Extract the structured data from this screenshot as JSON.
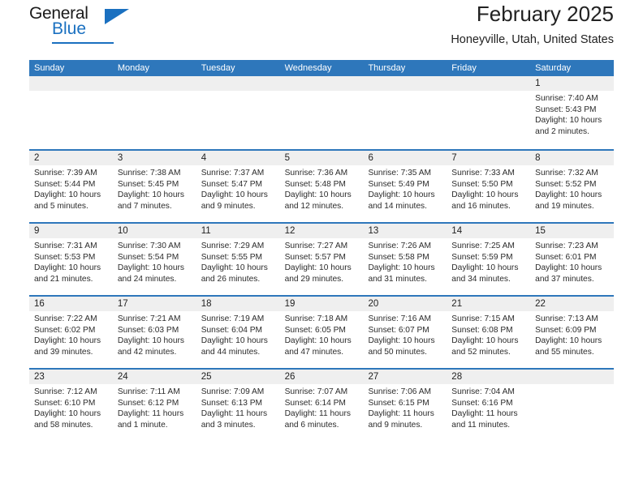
{
  "brand": {
    "name_part1": "General",
    "name_part2": "Blue",
    "accent_color": "#1a70c0",
    "triangle_icon": "triangle-icon"
  },
  "header": {
    "title": "February 2025",
    "subtitle": "Honeyville, Utah, United States"
  },
  "calendar": {
    "header_bg": "#2e77bb",
    "header_text_color": "#ffffff",
    "daynum_band_bg": "#efefef",
    "weekdays": [
      "Sunday",
      "Monday",
      "Tuesday",
      "Wednesday",
      "Thursday",
      "Friday",
      "Saturday"
    ],
    "weeks": [
      [
        {
          "day": "",
          "sunrise": "",
          "sunset": "",
          "daylight": ""
        },
        {
          "day": "",
          "sunrise": "",
          "sunset": "",
          "daylight": ""
        },
        {
          "day": "",
          "sunrise": "",
          "sunset": "",
          "daylight": ""
        },
        {
          "day": "",
          "sunrise": "",
          "sunset": "",
          "daylight": ""
        },
        {
          "day": "",
          "sunrise": "",
          "sunset": "",
          "daylight": ""
        },
        {
          "day": "",
          "sunrise": "",
          "sunset": "",
          "daylight": ""
        },
        {
          "day": "1",
          "sunrise": "Sunrise: 7:40 AM",
          "sunset": "Sunset: 5:43 PM",
          "daylight": "Daylight: 10 hours and 2 minutes."
        }
      ],
      [
        {
          "day": "2",
          "sunrise": "Sunrise: 7:39 AM",
          "sunset": "Sunset: 5:44 PM",
          "daylight": "Daylight: 10 hours and 5 minutes."
        },
        {
          "day": "3",
          "sunrise": "Sunrise: 7:38 AM",
          "sunset": "Sunset: 5:45 PM",
          "daylight": "Daylight: 10 hours and 7 minutes."
        },
        {
          "day": "4",
          "sunrise": "Sunrise: 7:37 AM",
          "sunset": "Sunset: 5:47 PM",
          "daylight": "Daylight: 10 hours and 9 minutes."
        },
        {
          "day": "5",
          "sunrise": "Sunrise: 7:36 AM",
          "sunset": "Sunset: 5:48 PM",
          "daylight": "Daylight: 10 hours and 12 minutes."
        },
        {
          "day": "6",
          "sunrise": "Sunrise: 7:35 AM",
          "sunset": "Sunset: 5:49 PM",
          "daylight": "Daylight: 10 hours and 14 minutes."
        },
        {
          "day": "7",
          "sunrise": "Sunrise: 7:33 AM",
          "sunset": "Sunset: 5:50 PM",
          "daylight": "Daylight: 10 hours and 16 minutes."
        },
        {
          "day": "8",
          "sunrise": "Sunrise: 7:32 AM",
          "sunset": "Sunset: 5:52 PM",
          "daylight": "Daylight: 10 hours and 19 minutes."
        }
      ],
      [
        {
          "day": "9",
          "sunrise": "Sunrise: 7:31 AM",
          "sunset": "Sunset: 5:53 PM",
          "daylight": "Daylight: 10 hours and 21 minutes."
        },
        {
          "day": "10",
          "sunrise": "Sunrise: 7:30 AM",
          "sunset": "Sunset: 5:54 PM",
          "daylight": "Daylight: 10 hours and 24 minutes."
        },
        {
          "day": "11",
          "sunrise": "Sunrise: 7:29 AM",
          "sunset": "Sunset: 5:55 PM",
          "daylight": "Daylight: 10 hours and 26 minutes."
        },
        {
          "day": "12",
          "sunrise": "Sunrise: 7:27 AM",
          "sunset": "Sunset: 5:57 PM",
          "daylight": "Daylight: 10 hours and 29 minutes."
        },
        {
          "day": "13",
          "sunrise": "Sunrise: 7:26 AM",
          "sunset": "Sunset: 5:58 PM",
          "daylight": "Daylight: 10 hours and 31 minutes."
        },
        {
          "day": "14",
          "sunrise": "Sunrise: 7:25 AM",
          "sunset": "Sunset: 5:59 PM",
          "daylight": "Daylight: 10 hours and 34 minutes."
        },
        {
          "day": "15",
          "sunrise": "Sunrise: 7:23 AM",
          "sunset": "Sunset: 6:01 PM",
          "daylight": "Daylight: 10 hours and 37 minutes."
        }
      ],
      [
        {
          "day": "16",
          "sunrise": "Sunrise: 7:22 AM",
          "sunset": "Sunset: 6:02 PM",
          "daylight": "Daylight: 10 hours and 39 minutes."
        },
        {
          "day": "17",
          "sunrise": "Sunrise: 7:21 AM",
          "sunset": "Sunset: 6:03 PM",
          "daylight": "Daylight: 10 hours and 42 minutes."
        },
        {
          "day": "18",
          "sunrise": "Sunrise: 7:19 AM",
          "sunset": "Sunset: 6:04 PM",
          "daylight": "Daylight: 10 hours and 44 minutes."
        },
        {
          "day": "19",
          "sunrise": "Sunrise: 7:18 AM",
          "sunset": "Sunset: 6:05 PM",
          "daylight": "Daylight: 10 hours and 47 minutes."
        },
        {
          "day": "20",
          "sunrise": "Sunrise: 7:16 AM",
          "sunset": "Sunset: 6:07 PM",
          "daylight": "Daylight: 10 hours and 50 minutes."
        },
        {
          "day": "21",
          "sunrise": "Sunrise: 7:15 AM",
          "sunset": "Sunset: 6:08 PM",
          "daylight": "Daylight: 10 hours and 52 minutes."
        },
        {
          "day": "22",
          "sunrise": "Sunrise: 7:13 AM",
          "sunset": "Sunset: 6:09 PM",
          "daylight": "Daylight: 10 hours and 55 minutes."
        }
      ],
      [
        {
          "day": "23",
          "sunrise": "Sunrise: 7:12 AM",
          "sunset": "Sunset: 6:10 PM",
          "daylight": "Daylight: 10 hours and 58 minutes."
        },
        {
          "day": "24",
          "sunrise": "Sunrise: 7:11 AM",
          "sunset": "Sunset: 6:12 PM",
          "daylight": "Daylight: 11 hours and 1 minute."
        },
        {
          "day": "25",
          "sunrise": "Sunrise: 7:09 AM",
          "sunset": "Sunset: 6:13 PM",
          "daylight": "Daylight: 11 hours and 3 minutes."
        },
        {
          "day": "26",
          "sunrise": "Sunrise: 7:07 AM",
          "sunset": "Sunset: 6:14 PM",
          "daylight": "Daylight: 11 hours and 6 minutes."
        },
        {
          "day": "27",
          "sunrise": "Sunrise: 7:06 AM",
          "sunset": "Sunset: 6:15 PM",
          "daylight": "Daylight: 11 hours and 9 minutes."
        },
        {
          "day": "28",
          "sunrise": "Sunrise: 7:04 AM",
          "sunset": "Sunset: 6:16 PM",
          "daylight": "Daylight: 11 hours and 11 minutes."
        },
        {
          "day": "",
          "sunrise": "",
          "sunset": "",
          "daylight": ""
        }
      ]
    ]
  }
}
